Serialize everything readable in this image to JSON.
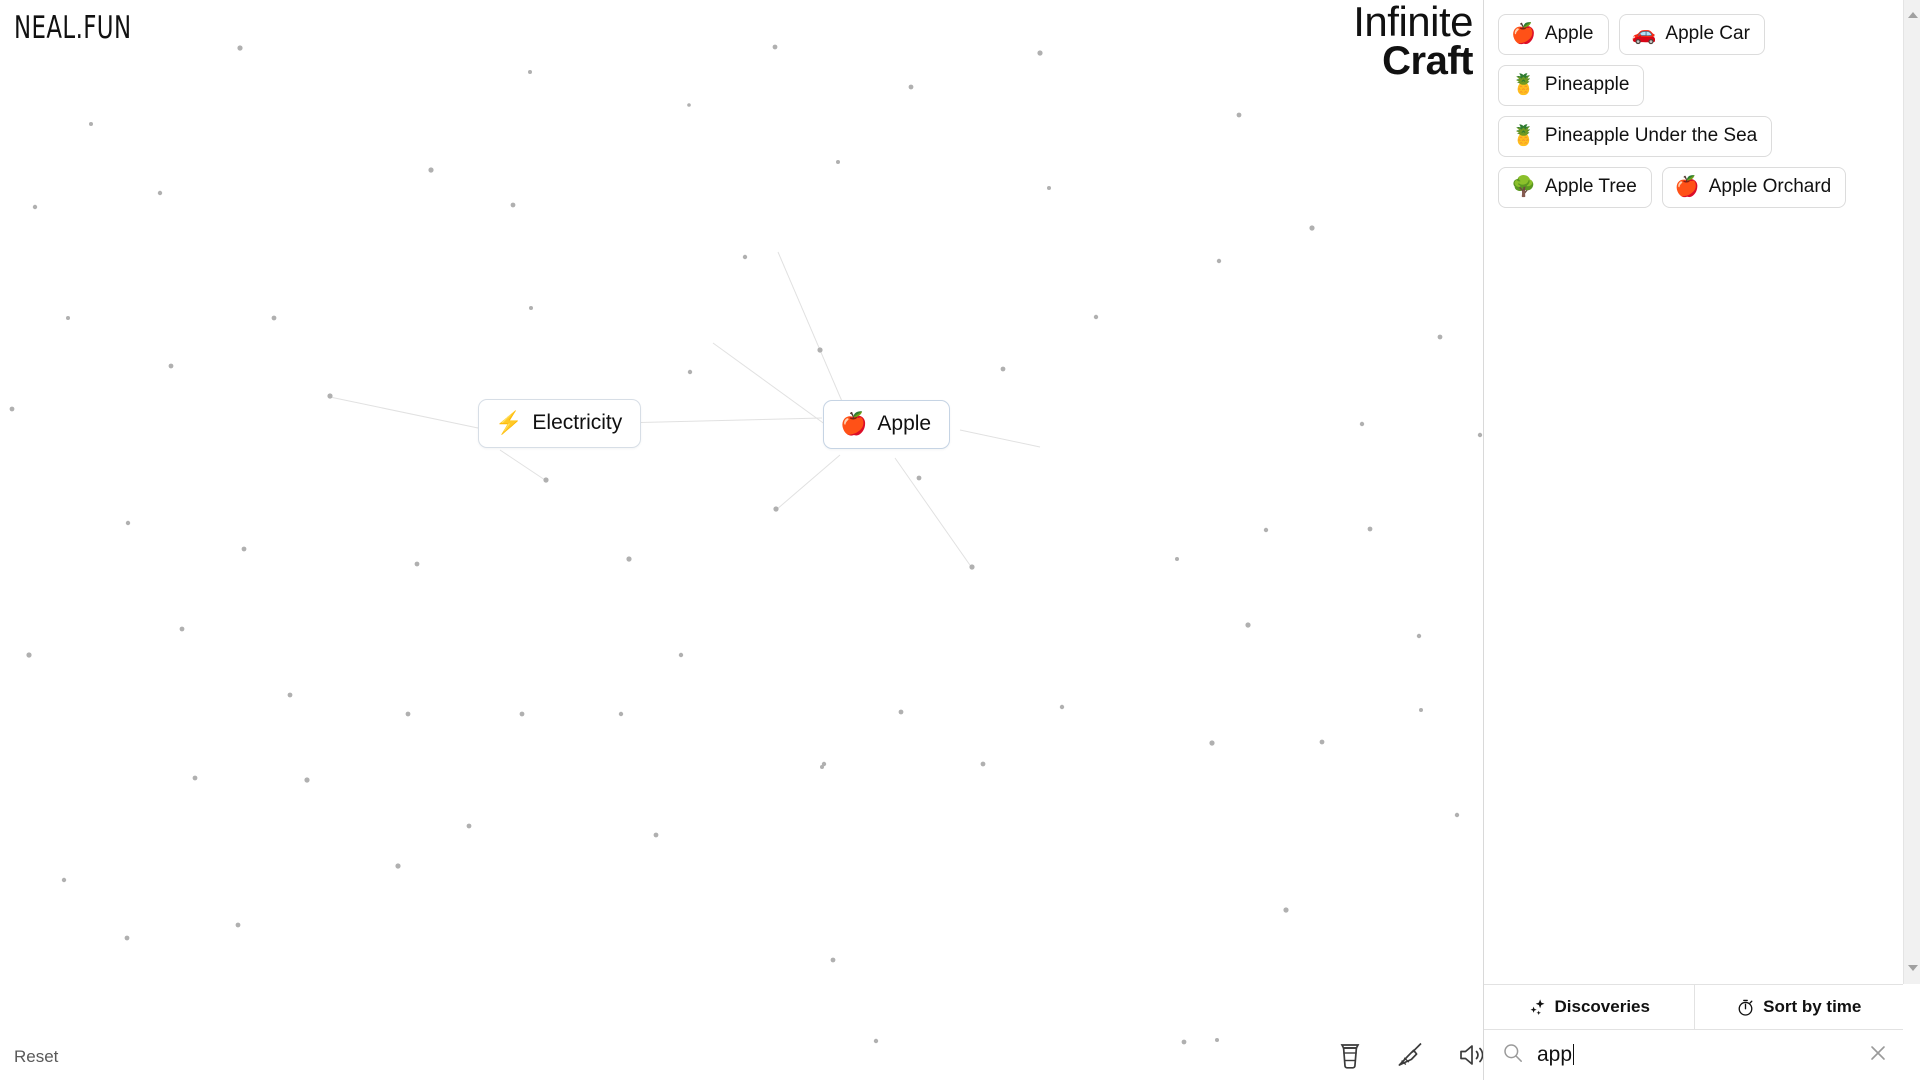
{
  "brand": {
    "label": "NEAL.FUN"
  },
  "title": {
    "line1": "Infinite",
    "line2": "Craft"
  },
  "canvas": {
    "reset_label": "Reset",
    "nodes": [
      {
        "emoji": "⚡",
        "label": "Electricity",
        "icon": "lightning-icon"
      },
      {
        "emoji": "🍎",
        "label": "Apple",
        "icon": "apple-icon"
      }
    ],
    "tools": [
      {
        "name": "coffee-icon",
        "label": "Coffee"
      },
      {
        "name": "broom-icon",
        "label": "Clear"
      },
      {
        "name": "speaker-icon",
        "label": "Sound"
      }
    ]
  },
  "sidebar": {
    "items": [
      {
        "emoji": "🍎",
        "label": "Apple"
      },
      {
        "emoji": "🚗",
        "label": "Apple Car"
      },
      {
        "emoji": "🍍",
        "label": "Pineapple"
      },
      {
        "emoji": "🍍",
        "label": "Pineapple Under the Sea"
      },
      {
        "emoji": "🌳",
        "label": "Apple Tree"
      },
      {
        "emoji": "🍎",
        "label": "Apple Orchard"
      }
    ],
    "controls": [
      {
        "name": "discoveries",
        "label": "Discoveries",
        "icon": "sparkles-icon"
      },
      {
        "name": "sort-by-time",
        "label": "Sort by time",
        "icon": "stopwatch-icon"
      }
    ],
    "search": {
      "value": "app",
      "placeholder": "Search",
      "icon": "search-icon",
      "clear_icon": "close-icon"
    },
    "scrollbar": {
      "up_icon": "chevron-up-icon",
      "down_icon": "chevron-down-icon"
    }
  },
  "colors": {
    "background": "#ffffff",
    "node_border": "#d7dee6",
    "item_border": "#dcdcdc",
    "text": "#111111",
    "muted": "#595959",
    "particle": "#b8b8b8"
  }
}
